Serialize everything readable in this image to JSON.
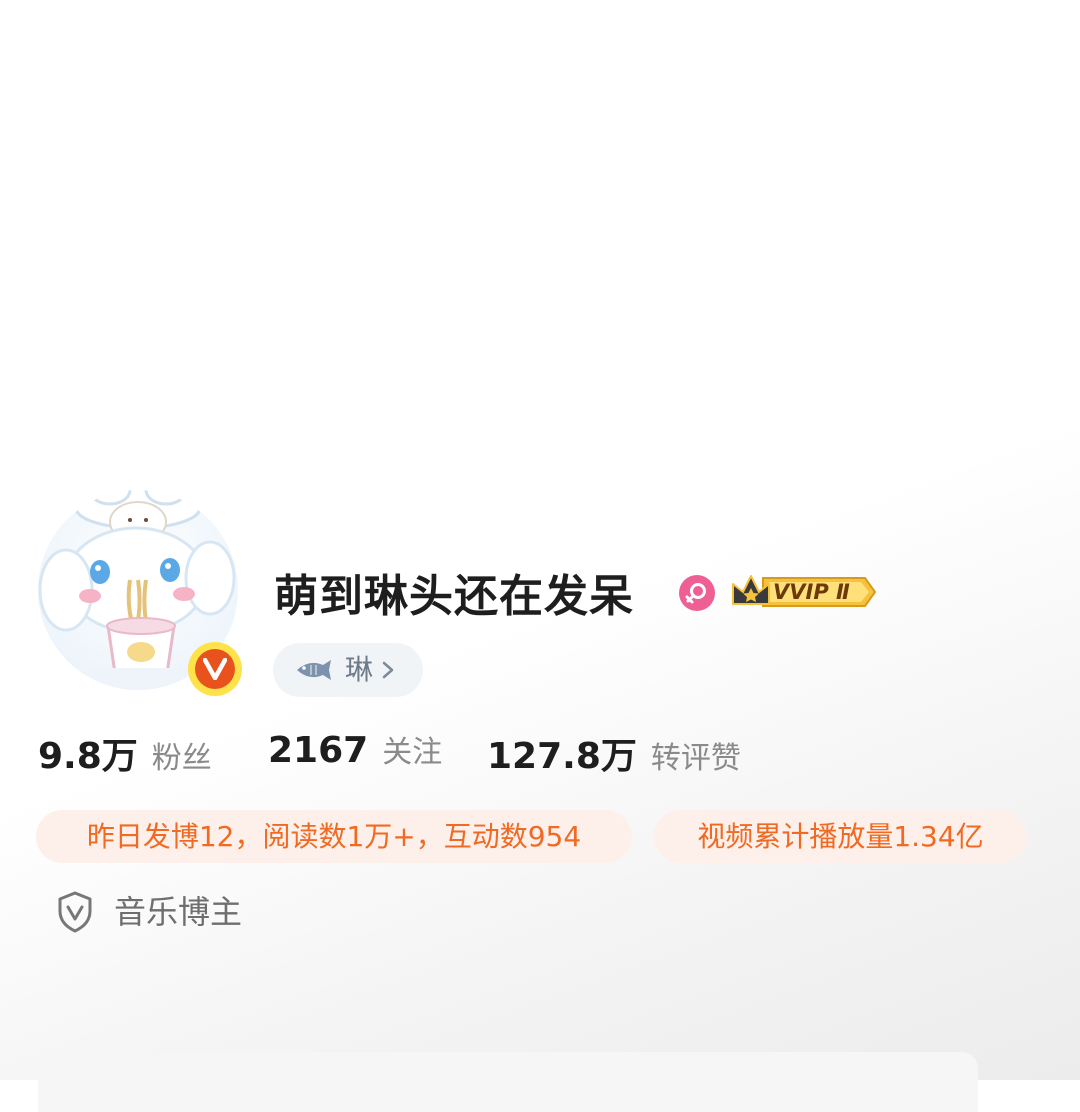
{
  "profile": {
    "username": "萌到琳头还在发呆",
    "gender": "female",
    "vip_label": "VVIP Ⅱ",
    "verified": true,
    "fan_group": {
      "name": "琳",
      "icon": "fish-icon"
    },
    "avatar": {
      "icon": "cinnamoroll-avatar"
    }
  },
  "stats": {
    "fans_value": "9.8万",
    "fans_label": "粉丝",
    "following_value": "2167",
    "following_label": "关注",
    "likes_value": "127.8万",
    "likes_label": "转评赞"
  },
  "highlights": {
    "yesterday": "昨日发博12，阅读数1万+，互动数954",
    "video": "视频累计播放量1.34亿"
  },
  "tag": {
    "icon": "shield-icon",
    "label": "音乐博主"
  },
  "colors": {
    "accent_orange": "#f06a23",
    "pill_bg": "#fdf0ea",
    "verified_red": "#e8521c",
    "verified_ring": "#ffe24a",
    "gender_pink": "#ee5f93",
    "vip_gold": "#f7c23b"
  }
}
